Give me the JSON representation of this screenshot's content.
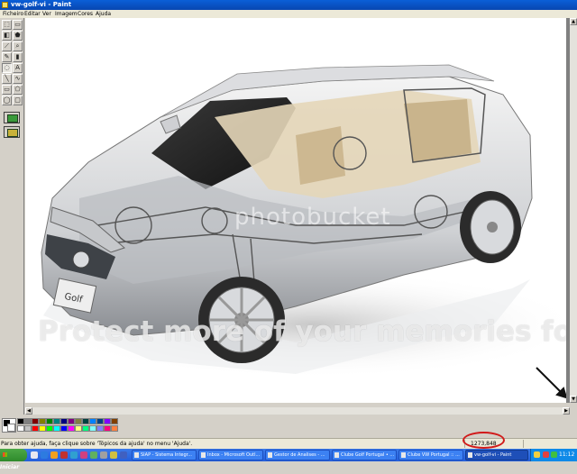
{
  "window": {
    "title": "vw-golf-vi - Paint"
  },
  "menu": [
    "Ficheiro",
    "Editar",
    "Ver",
    "Imagem",
    "Cores",
    "Ajuda"
  ],
  "tools": [
    "free-select-icon",
    "rect-select-icon",
    "eraser-icon",
    "fill-bucket-icon",
    "color-picker-icon",
    "magnifier-icon",
    "pencil-icon",
    "brush-icon",
    "airbrush-icon",
    "text-icon",
    "line-icon",
    "curve-icon",
    "rectangle-icon",
    "polygon-icon",
    "ellipse-icon",
    "rounded-rect-icon"
  ],
  "tool_glyphs": [
    "⬚",
    "▭",
    "◧",
    "⬟",
    "⟋",
    "⌕",
    "✎",
    "▮",
    "◌",
    "A",
    "╲",
    "∿",
    "▭",
    "⬠",
    "◯",
    "▢"
  ],
  "image": {
    "watermark_logo": "photobucket",
    "watermark_text": "Protect more of your memories for less!",
    "badge": "Golf"
  },
  "palette": [
    "#000000",
    "#808080",
    "#800000",
    "#808000",
    "#008000",
    "#008080",
    "#000080",
    "#800080",
    "#808040",
    "#004040",
    "#0080ff",
    "#004080",
    "#8000ff",
    "#804000",
    "#ffffff",
    "#c0c0c0",
    "#ff0000",
    "#ffff00",
    "#00ff00",
    "#00ffff",
    "#0000ff",
    "#ff00ff",
    "#ffff80",
    "#00ff80",
    "#80ffff",
    "#8080ff",
    "#ff0080",
    "#ff8040"
  ],
  "status": {
    "hint": "Para obter ajuda, faça clique sobre 'Tópicos da ajuda' no menu 'Ajuda'.",
    "coords": "1273,848"
  },
  "taskbar": {
    "start_label": "Iniciar",
    "tasks": [
      "SIAP - Sistema Integr...",
      "Inbox - Microsoft Outl...",
      "Gestor de Analises - ...",
      "Clube Golf Portugal • ...",
      "Clube VW Portugal :: ...",
      "vw-golf-vi - Paint"
    ],
    "clock": "11:12"
  }
}
